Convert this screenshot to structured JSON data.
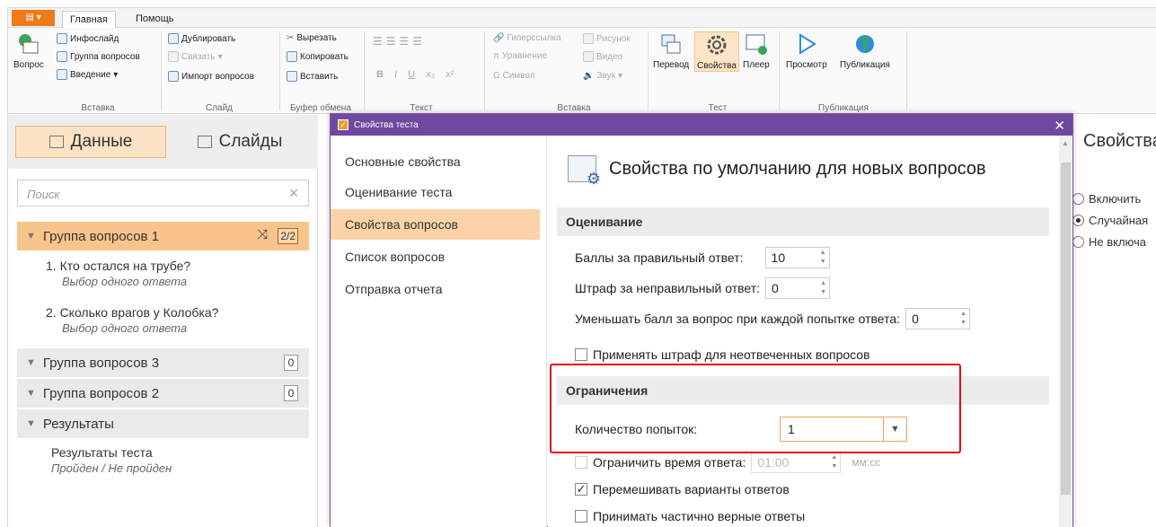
{
  "ribbon": {
    "tabs": [
      {
        "label": "Главная"
      },
      {
        "label": "Помощь"
      }
    ],
    "groups": {
      "insert1": {
        "label": "Вставка",
        "question": "Вопрос",
        "infoslide": "Инфослайд",
        "question_group": "Группа вопросов",
        "intro": "Введение"
      },
      "slide": {
        "label": "Слайд",
        "duplicate": "Дублировать",
        "link": "Связать",
        "import": "Импорт вопросов"
      },
      "clipboard": {
        "label": "Буфер обмена",
        "cut": "Вырезать",
        "copy": "Копировать",
        "paste": "Вставить"
      },
      "text": {
        "label": "Текст"
      },
      "insert2": {
        "label": "Вставка",
        "hyperlink": "Гиперссылка",
        "equation": "Уравнение",
        "symbol": "Символ",
        "picture": "Рисунок",
        "video": "Видео",
        "sound": "Звук"
      },
      "test": {
        "label": "Тест",
        "translate": "Перевод",
        "properties": "Свойства",
        "player": "Плеер"
      },
      "publish": {
        "label": "Публикация",
        "preview": "Просмотр",
        "publication": "Публикация"
      }
    }
  },
  "left_panel": {
    "tab_data": "Данные",
    "tab_slides": "Слайды",
    "search_placeholder": "Поиск",
    "groups": [
      {
        "title": "Группа вопросов 1",
        "badge": "2/2",
        "questions": [
          {
            "title": "1. Кто остался на трубе?",
            "type": "Выбор одного ответа"
          },
          {
            "title": "2. Сколько врагов у Колобка?",
            "type": "Выбор одного ответа"
          }
        ]
      },
      {
        "title": "Группа вопросов 3",
        "badge": "0"
      },
      {
        "title": "Группа вопросов 2",
        "badge": "0"
      },
      {
        "title": "Результаты"
      }
    ],
    "results": {
      "title": "Результаты теста",
      "subtitle": "Пройден / Не пройден"
    }
  },
  "right_panel": {
    "title": "Свойства",
    "options": [
      {
        "label": "Включить",
        "selected": false
      },
      {
        "label": "Случайная",
        "selected": true
      },
      {
        "label": "Не включа",
        "selected": false
      }
    ]
  },
  "dialog": {
    "title": "Свойства теста",
    "nav": [
      {
        "label": "Основные свойства"
      },
      {
        "label": "Оценивание теста"
      },
      {
        "label": "Свойства вопросов"
      },
      {
        "label": "Список вопросов"
      },
      {
        "label": "Отправка отчета"
      }
    ],
    "content_title": "Свойства по умолчанию для новых вопросов",
    "section_scoring": "Оценивание",
    "points_correct_label": "Баллы за правильный ответ:",
    "points_correct_value": "10",
    "penalty_label": "Штраф за неправильный ответ:",
    "penalty_value": "0",
    "decrease_label": "Уменьшать балл за вопрос при каждой попытке ответа:",
    "decrease_value": "0",
    "apply_penalty_label": "Применять штраф для неотвеченных вопросов",
    "section_limits": "Ограничения",
    "attempts_label": "Количество попыток:",
    "attempts_value": "1",
    "limit_time_label": "Ограничить время ответа:",
    "limit_time_value": "01:00",
    "time_unit": "мм:сс",
    "shuffle_label": "Перемешивать варианты ответов",
    "partial_label": "Принимать частично верные ответы"
  }
}
